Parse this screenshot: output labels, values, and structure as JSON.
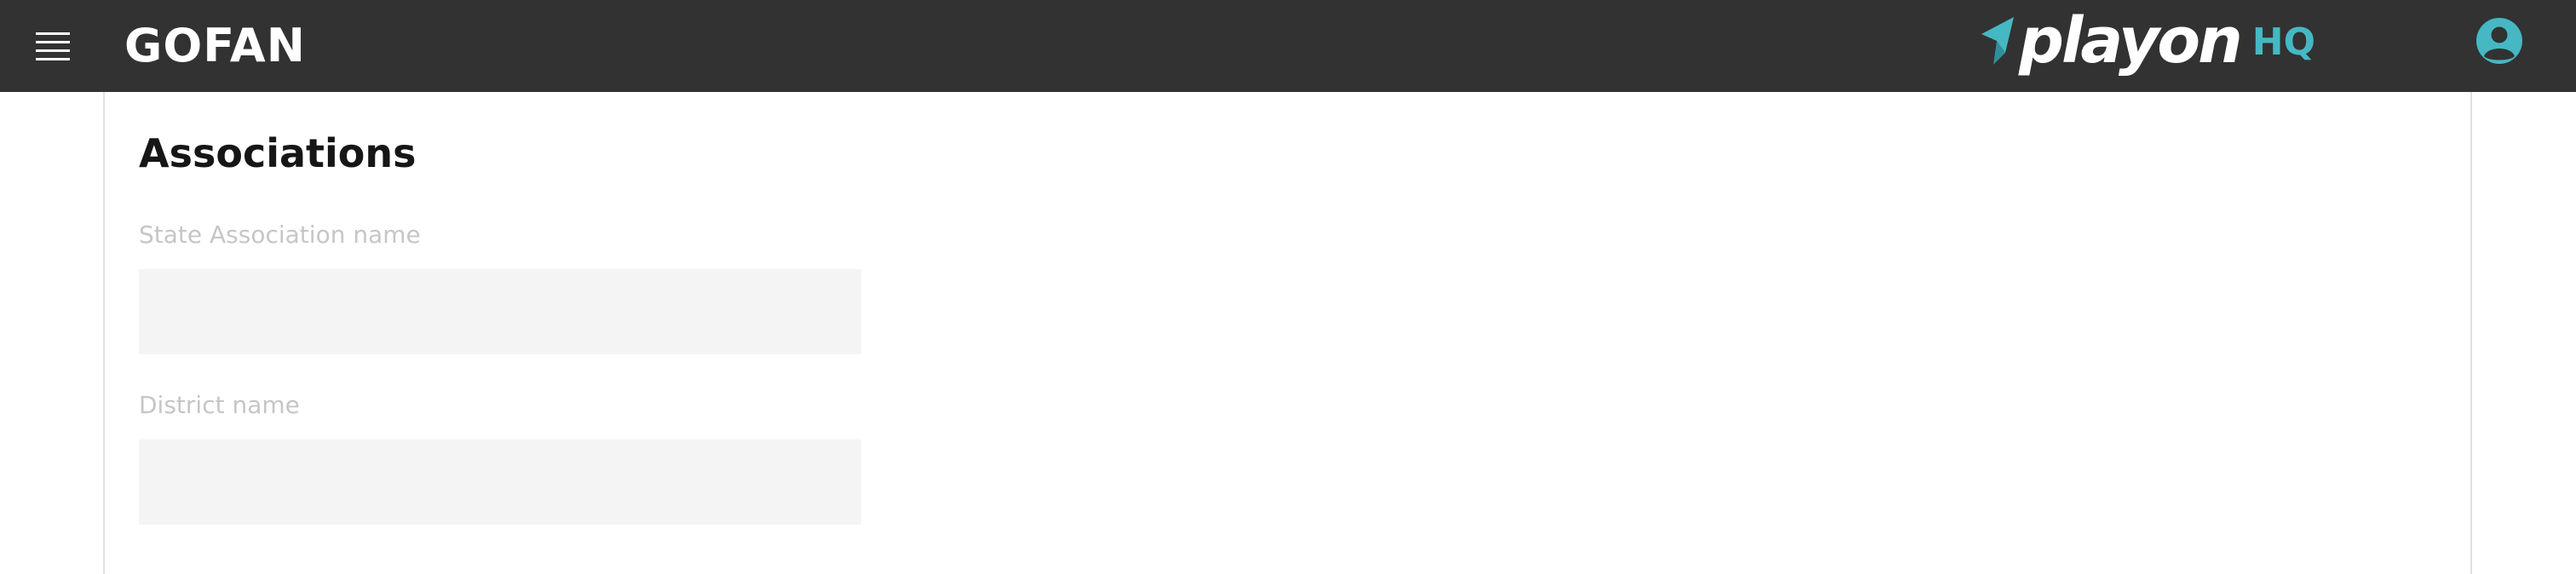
{
  "header": {
    "brand": "GOFAN",
    "logo_wordmark": "playon",
    "logo_suffix": "HQ",
    "menu_icon": "hamburger-menu-icon",
    "user_icon": "user-avatar-icon"
  },
  "colors": {
    "header_bg": "#323232",
    "accent": "#45b8c4",
    "label": "#c6c6c6",
    "input_bg": "#f4f4f4",
    "title": "#161616"
  },
  "main": {
    "title": "Associations",
    "fields": [
      {
        "label": "State Association name",
        "value": "",
        "placeholder": ""
      },
      {
        "label": "District name",
        "value": "",
        "placeholder": ""
      }
    ]
  }
}
